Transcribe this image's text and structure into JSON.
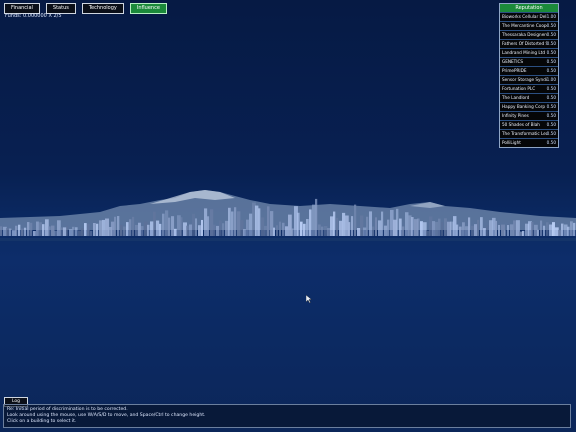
{
  "tabs": [
    {
      "label": "Financial",
      "active": false
    },
    {
      "label": "Status",
      "active": false
    },
    {
      "label": "Technology",
      "active": false
    },
    {
      "label": "Influence",
      "active": true
    }
  ],
  "funds_text": "Funds: 0.000000 X 2/5",
  "reputation": {
    "title": "Reputation",
    "rows": [
      {
        "name": "Bioworks Cellular Deliveries",
        "value": "1.00"
      },
      {
        "name": "The Mercantine Cooperative",
        "value": "0.50"
      },
      {
        "name": "Thessaraka Designers",
        "value": "0.50"
      },
      {
        "name": "Fathers Of Distorted Sea",
        "value": "0.50"
      },
      {
        "name": "Landrand Mining Ltd",
        "value": "0.50"
      },
      {
        "name": "GENETICS",
        "value": "0.50"
      },
      {
        "name": "PrimePRIDE",
        "value": "0.50"
      },
      {
        "name": "Sensor Storage Syndicate",
        "value": "1.00"
      },
      {
        "name": "Fortunation PLC",
        "value": "0.50"
      },
      {
        "name": "The Landlord",
        "value": "0.50"
      },
      {
        "name": "Happy Banking Corp",
        "value": "0.50"
      },
      {
        "name": "Infinity Pines",
        "value": "0.50"
      },
      {
        "name": "50 Shades of Blah",
        "value": "0.50"
      },
      {
        "name": "The Transformatic League",
        "value": "0.50"
      },
      {
        "name": "PolliLight",
        "value": "0.50"
      }
    ]
  },
  "log": {
    "tab_label": "Log",
    "lines": [
      "Re: Initial period of discrimination is to be corrected.",
      "Look around using the mouse, use W/A/S/D to move, and Space/Ctrl to change height.",
      "Click on a building to select it."
    ]
  },
  "colors": {
    "active_tab": "#1b8a3a",
    "sky_top": "#061a44",
    "sea": "#0d2d6a"
  }
}
